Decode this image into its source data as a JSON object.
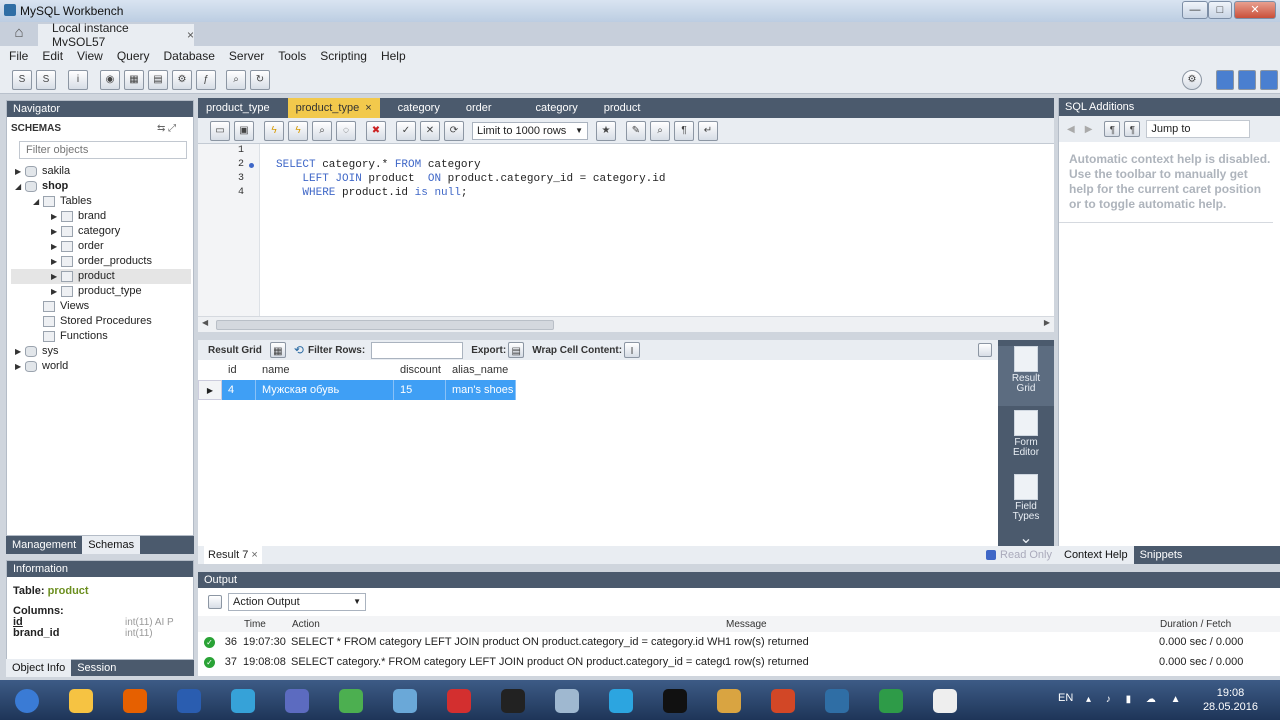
{
  "window": {
    "title": "MySQL Workbench",
    "minimize": "—",
    "maximize": "□",
    "close": "✕"
  },
  "tabs": {
    "instance": "Local instance MySQL57",
    "close": "×"
  },
  "menu": [
    "File",
    "Edit",
    "View",
    "Query",
    "Database",
    "Server",
    "Tools",
    "Scripting",
    "Help"
  ],
  "navigator": {
    "title": "Navigator",
    "schemas_label": "SCHEMAS",
    "filter_placeholder": "Filter objects",
    "tree": [
      {
        "label": "sakila",
        "level": 0,
        "type": "db"
      },
      {
        "label": "shop",
        "level": 0,
        "type": "db",
        "bold": true
      },
      {
        "label": "Tables",
        "level": 1,
        "type": "folder"
      },
      {
        "label": "brand",
        "level": 2,
        "type": "table"
      },
      {
        "label": "category",
        "level": 2,
        "type": "table"
      },
      {
        "label": "order",
        "level": 2,
        "type": "table"
      },
      {
        "label": "order_products",
        "level": 2,
        "type": "table"
      },
      {
        "label": "product",
        "level": 2,
        "type": "table",
        "selected": true
      },
      {
        "label": "product_type",
        "level": 2,
        "type": "table"
      },
      {
        "label": "Views",
        "level": 1,
        "type": "folder"
      },
      {
        "label": "Stored Procedures",
        "level": 1,
        "type": "folder"
      },
      {
        "label": "Functions",
        "level": 1,
        "type": "folder"
      },
      {
        "label": "sys",
        "level": 0,
        "type": "db"
      },
      {
        "label": "world",
        "level": 0,
        "type": "db"
      }
    ],
    "bottom_tabs": [
      "Management",
      "Schemas"
    ]
  },
  "information": {
    "title": "Information",
    "table_label": "Table:",
    "table_name": "product",
    "columns_label": "Columns:",
    "columns": [
      {
        "name": "id",
        "type": "int(11) AI P"
      },
      {
        "name": "brand_id",
        "type": "int(11)"
      }
    ],
    "tabs": [
      "Object Info",
      "Session"
    ]
  },
  "editor_tabs": [
    {
      "label": "product_type",
      "active": false
    },
    {
      "label": "product_type",
      "active": true,
      "close": "×"
    },
    {
      "label": "category",
      "active": false
    },
    {
      "label": "order",
      "active": false
    },
    {
      "label": "category",
      "active": false
    },
    {
      "label": "product",
      "active": false
    }
  ],
  "sql_toolbar": {
    "limit": "Limit to 1000 rows"
  },
  "editor": {
    "line_numbers": [
      "1",
      "2",
      "3",
      "4"
    ],
    "lines": [
      {
        "indent": "",
        "parts": []
      },
      {
        "indent": "",
        "parts": [
          {
            "t": "SELECT",
            "kw": true
          },
          {
            "t": " category.* ",
            "kw": false
          },
          {
            "t": "FROM",
            "kw": true
          },
          {
            "t": " category",
            "kw": false
          }
        ]
      },
      {
        "indent": "    ",
        "parts": [
          {
            "t": "LEFT JOIN",
            "kw": true
          },
          {
            "t": " product  ",
            "kw": false
          },
          {
            "t": "ON",
            "kw": true
          },
          {
            "t": " product.category_id = category.id",
            "kw": false
          }
        ]
      },
      {
        "indent": "    ",
        "parts": [
          {
            "t": "WHERE",
            "kw": true
          },
          {
            "t": " product.id ",
            "kw": false
          },
          {
            "t": "is",
            "kw": true
          },
          {
            "t": " ",
            "kw": false
          },
          {
            "t": "null",
            "kw": true
          },
          {
            "t": ";",
            "kw": false
          }
        ]
      }
    ]
  },
  "result_toolbar": {
    "result_grid": "Result Grid",
    "filter_rows": "Filter Rows:",
    "export": "Export:",
    "wrap": "Wrap Cell Content:"
  },
  "grid": {
    "columns": [
      "id",
      "name",
      "discount",
      "alias_name"
    ],
    "rows": [
      [
        "4",
        "Мужская обувь",
        "15",
        "man's shoes"
      ]
    ]
  },
  "side_panel": [
    {
      "label": "Result\nGrid"
    },
    {
      "label": "Form\nEditor"
    },
    {
      "label": "Field\nTypes"
    }
  ],
  "result_tab": {
    "label": "Result 7",
    "close": "×",
    "read_only": "Read Only"
  },
  "sql_additions": {
    "title": "SQL Additions",
    "jump_to": "Jump to",
    "help_text": "Automatic context help is disabled. Use the toolbar to manually get help for the current caret position or to toggle automatic help.",
    "tabs": [
      "Context Help",
      "Snippets"
    ]
  },
  "output": {
    "title": "Output",
    "selector": "Action Output",
    "headers": [
      "Time",
      "Action",
      "Message",
      "Duration / Fetch"
    ],
    "rows": [
      {
        "num": "36",
        "time": "19:07:30",
        "action": "SELECT * FROM category LEFT JOIN product  ON product.category_id = category.id     WHE...",
        "message": "1 row(s) returned",
        "duration": "0.000 sec / 0.000 sec"
      },
      {
        "num": "37",
        "time": "19:08:08",
        "action": "SELECT category.* FROM category LEFT JOIN product  ON product.category_id = category.i...",
        "message": "1 row(s) returned",
        "duration": "0.000 sec / 0.000 sec"
      }
    ]
  },
  "taskbar": {
    "apps": [
      "start",
      "explorer",
      "firefox",
      "workbench-blue",
      "network-app",
      "settings-app",
      "chrome",
      "qip",
      "opera",
      "inkscape",
      "calculator",
      "telegram",
      "cmd",
      "video-editor",
      "powerpoint",
      "workbench-dolphin",
      "camtasia-green",
      "camtasia-white"
    ],
    "colors": [
      "#3a7bd5",
      "#f6c342",
      "#e66000",
      "#2a5db0",
      "#36a2d8",
      "#5c6bc0",
      "#4caf50",
      "#6aa8d8",
      "#d32f2f",
      "#222222",
      "#9fb8d0",
      "#2ca5e0",
      "#111111",
      "#d9a441",
      "#d24726",
      "#2f6ea5",
      "#2e9b48",
      "#eeeeee"
    ],
    "lang": "EN",
    "time": "19:08",
    "date": "28.05.2016"
  }
}
